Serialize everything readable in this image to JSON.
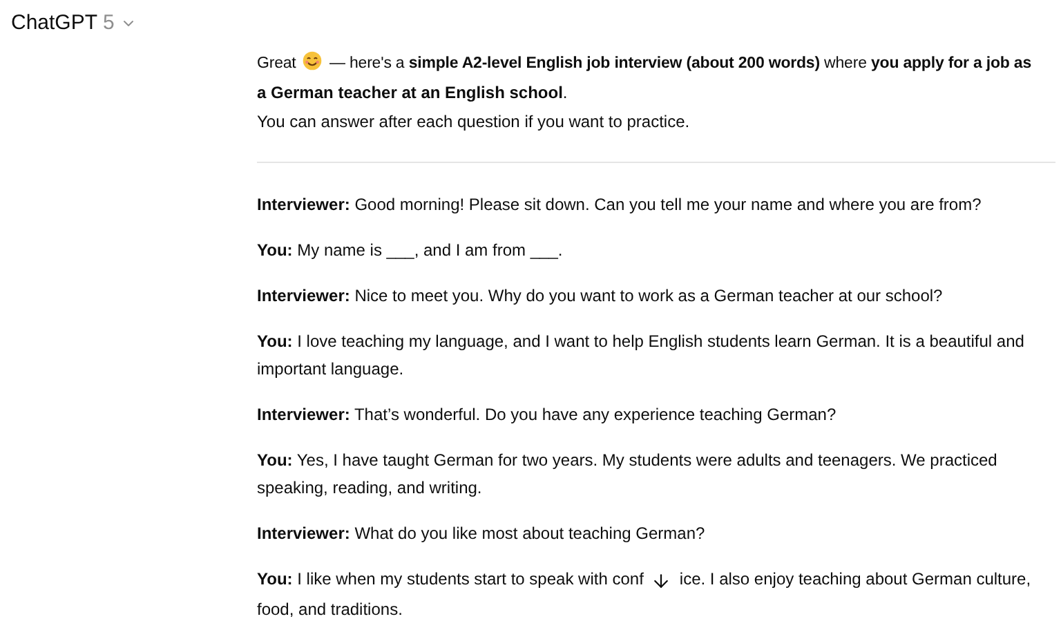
{
  "header": {
    "title": "ChatGPT",
    "model": "5"
  },
  "intro": {
    "before_emoji": "Great",
    "after_emoji": "— here's a **simple A2-level English job interview (about 200 words)** where **you apply for a job as**",
    "second_line": "**a German teacher at an English school**.",
    "note": "You can answer after each question if you want to practice."
  },
  "dialogue": [
    {
      "text": "**Interviewer:** Good morning! Please sit down. Can you tell me your name and where you are from?"
    },
    {
      "text": "**You:** My name is ___, and I am from ___."
    },
    {
      "text": "**Interviewer:** Nice to meet you. Why do you want to work as a German teacher at our school?"
    },
    {
      "text": "**You:** I love teaching my language, and I want to help English students learn German. It is a beautiful and important language."
    },
    {
      "text": "**Interviewer:** That’s wonderful. Do you have any experience teaching German?"
    },
    {
      "text": "**You:** Yes, I have taught German for two years. My students were adults and teenagers. We practiced speaking, reading, and writing."
    },
    {
      "text": "**Interviewer:** What do you like most about teaching German?"
    },
    {
      "text": "**You:** I like when my students start to speak with conf",
      "text_after_button": "ice. I also enjoy teaching about German culture,",
      "last_line": "food, and traditions."
    }
  ]
}
